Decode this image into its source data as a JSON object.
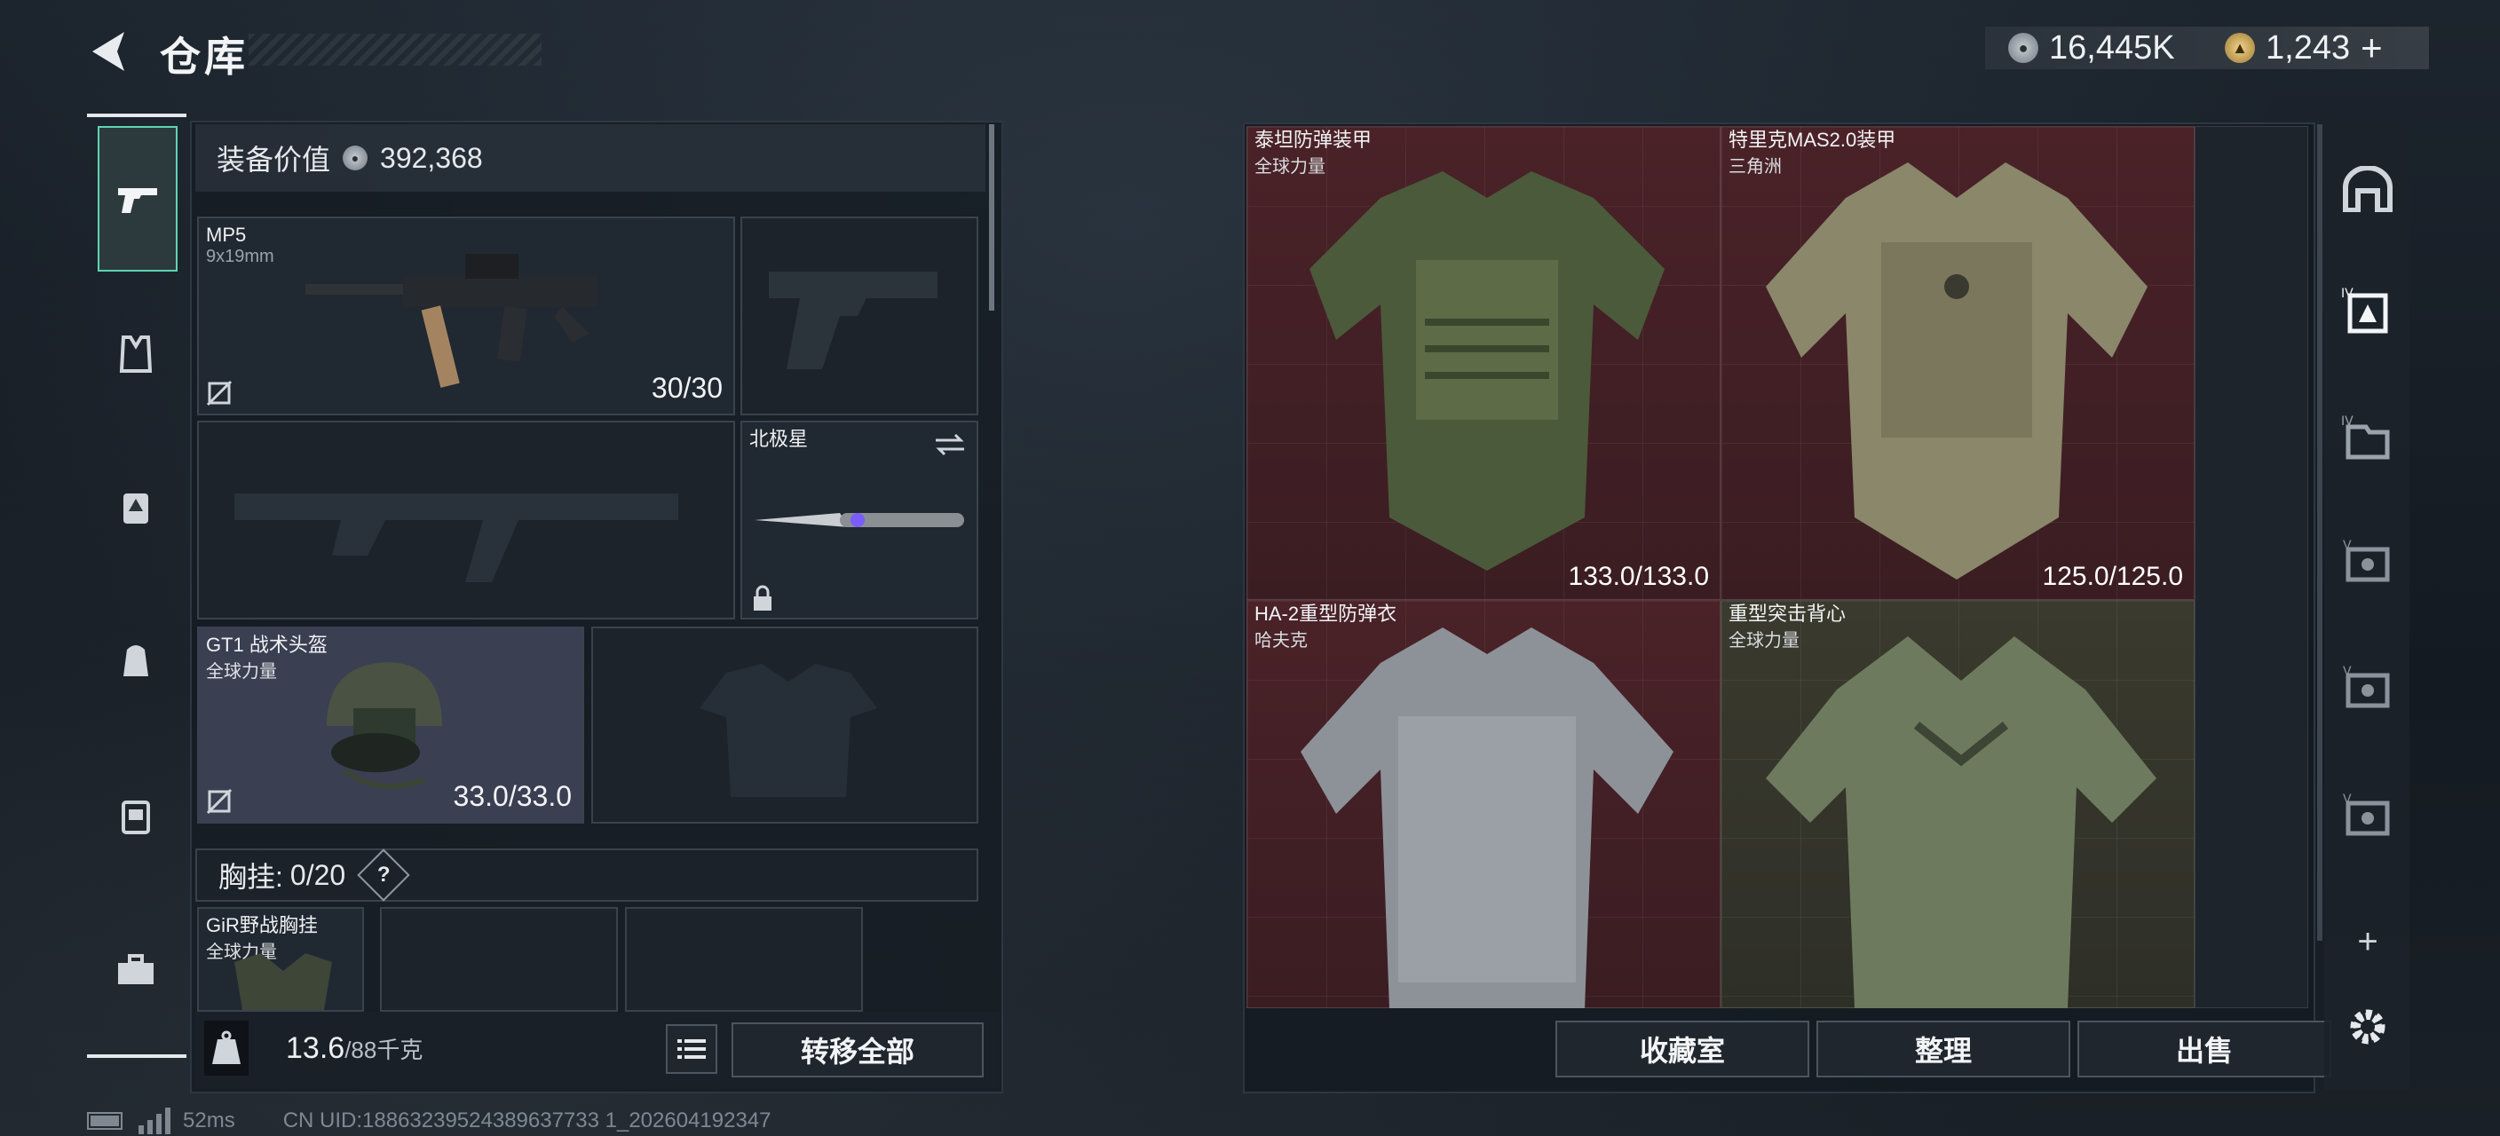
{
  "header": {
    "title": "仓库"
  },
  "currency": {
    "silver": "16,445K",
    "gold": "1,243",
    "plus": "+"
  },
  "loadout": {
    "value_label": "装备价值",
    "value": "392,368",
    "primary": {
      "name": "MP5",
      "caliber": "9x19mm",
      "ammo": "30/30"
    },
    "melee": {
      "name": "北极星"
    },
    "helmet": {
      "name": "GT1 战术头盔",
      "origin": "全球力量",
      "durability": "33.0/33.0"
    },
    "chest_rig_label": "胸挂:",
    "chest_rig_capacity": "0/20",
    "chest_rig_help": "?",
    "rig_item": {
      "name": "GiR野战胸挂",
      "origin": "全球力量"
    },
    "weight": "13.6",
    "weight_max": "/88千克",
    "transfer_all": "转移全部"
  },
  "stash": {
    "items": [
      {
        "name": "泰坦防弹装甲",
        "origin": "全球力量",
        "durability": "133.0/133.0"
      },
      {
        "name": "特里克MAS2.0装甲",
        "origin": "三角洲",
        "durability": "125.0/125.0"
      },
      {
        "name": "HA-2重型防弹衣",
        "origin": "哈夫克",
        "durability": ""
      },
      {
        "name": "重型突击背心",
        "origin": "全球力量",
        "durability": ""
      }
    ],
    "buttons": {
      "collection": "收藏室",
      "sort": "整理",
      "sell": "出售"
    },
    "tab_plus": "+"
  },
  "status": {
    "ping": "52ms",
    "uid": "CN UID:18863239524389637733 1_202604192347"
  }
}
